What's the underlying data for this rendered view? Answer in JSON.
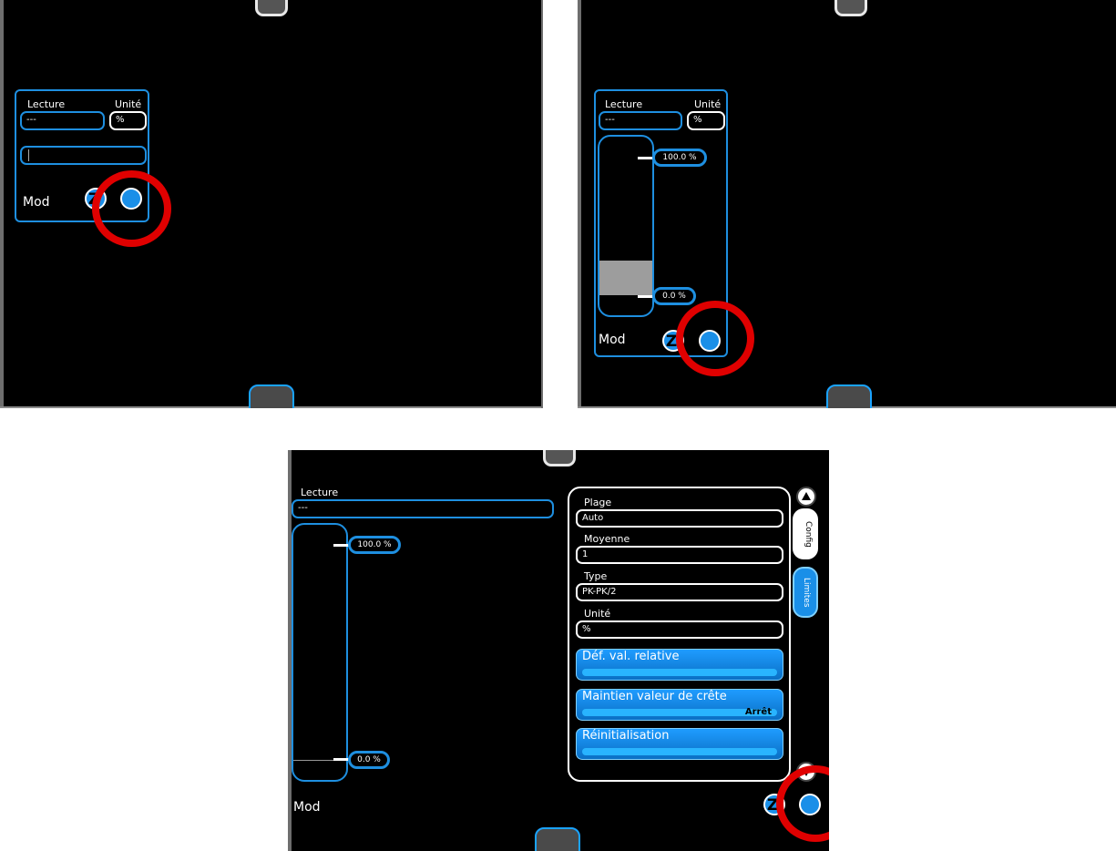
{
  "screen1": {
    "lecture_label": "Lecture",
    "unite_label": "Unité",
    "lecture_value": "---",
    "unite_value": "%",
    "mod_label": "Mod"
  },
  "screen2": {
    "lecture_label": "Lecture",
    "unite_label": "Unité",
    "lecture_value": "---",
    "unite_value": "%",
    "upper_limit": "100.0 %",
    "lower_limit": "0.0 %",
    "mod_label": "Mod"
  },
  "screen3": {
    "lecture_label": "Lecture",
    "lecture_value": "---",
    "upper_limit": "100.0 %",
    "lower_limit": "0.0 %",
    "mod_label": "Mod",
    "config": {
      "plage_label": "Plage",
      "plage_value": "Auto",
      "moyenne_label": "Moyenne",
      "moyenne_value": "1",
      "type_label": "Type",
      "type_value": "PK-PK/2",
      "unite_label": "Unité",
      "unite_value": "%",
      "btn_relative": "Déf. val. relative",
      "btn_peak": "Maintien valeur de crête",
      "btn_peak_value": "Arrêt",
      "btn_reset": "Réinitialisation"
    },
    "tabs": {
      "config": "Config",
      "limits": "Limites"
    }
  },
  "colors": {
    "accent": "#1e8fe0",
    "highlight_ring": "#e00000",
    "background": "#000000"
  }
}
